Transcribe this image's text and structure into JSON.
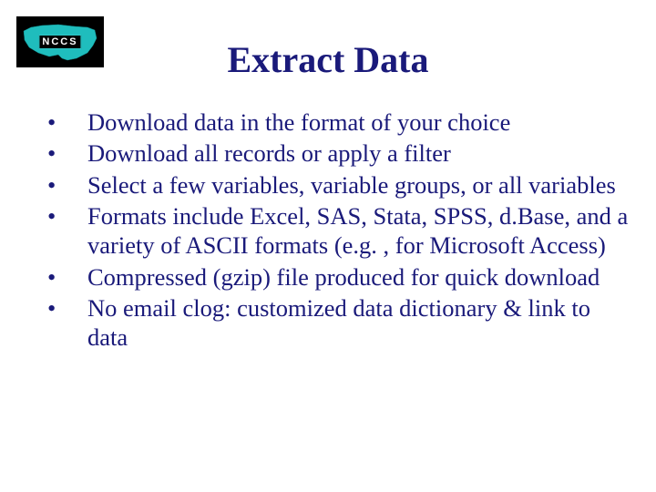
{
  "logo": {
    "text": "NCCS"
  },
  "title": "Extract Data",
  "bullets": [
    "Download data in the format of your choice",
    "Download all records or apply a filter",
    "Select a few variables, variable groups, or all variables",
    "Formats include Excel, SAS, Stata, SPSS, d.Base, and a variety of ASCII formats (e.g. , for Microsoft Access)",
    "Compressed (gzip) file produced for quick download",
    "No email clog:  customized data dictionary & link to data"
  ]
}
